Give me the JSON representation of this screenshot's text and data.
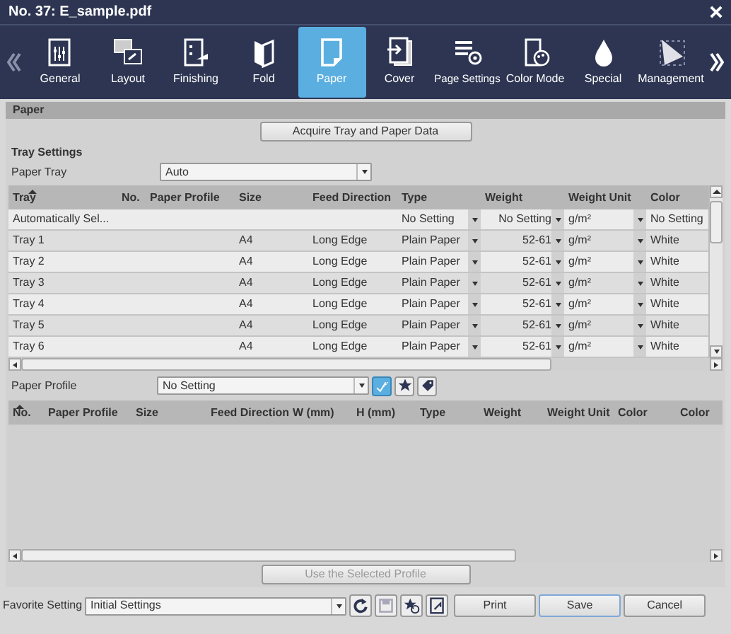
{
  "window": {
    "title": "No. 37: E_sample.pdf"
  },
  "tabs": [
    {
      "label": "General",
      "selected": false
    },
    {
      "label": "Layout",
      "selected": false
    },
    {
      "label": "Finishing",
      "selected": false
    },
    {
      "label": "Fold",
      "selected": false
    },
    {
      "label": "Paper",
      "selected": true
    },
    {
      "label": "Cover",
      "selected": false
    },
    {
      "label": "Page Settings",
      "selected": false
    },
    {
      "label": "Color Mode",
      "selected": false
    },
    {
      "label": "Special",
      "selected": false
    },
    {
      "label": "Management",
      "selected": false
    }
  ],
  "section_title": "Paper",
  "acquire_button": "Acquire Tray and Paper Data",
  "tray_settings": {
    "title": "Tray Settings",
    "paper_tray_label": "Paper Tray",
    "paper_tray_value": "Auto"
  },
  "tray_table": {
    "columns": [
      {
        "label": "Tray",
        "sorted": true
      },
      {
        "label": "No.",
        "sorted": false
      },
      {
        "label": "Paper Profile",
        "sorted": false
      },
      {
        "label": "Size",
        "sorted": false
      },
      {
        "label": "Feed Direction",
        "sorted": false
      },
      {
        "label": "Type",
        "sorted": false
      },
      {
        "label": "Weight",
        "sorted": false
      },
      {
        "label": "Weight Unit",
        "sorted": false
      },
      {
        "label": "Color",
        "sorted": false
      }
    ],
    "rows": [
      {
        "tray": "Automatically Sel...",
        "type": "No Setting",
        "weight": "No Setting",
        "unit": "g/m²",
        "paper_color": "No Setting"
      },
      {
        "tray": "Tray 1",
        "size": "A4",
        "feed": "Long Edge",
        "type": "Plain Paper",
        "weight": "52-61",
        "unit": "g/m²",
        "paper_color": "White"
      },
      {
        "tray": "Tray 2",
        "size": "A4",
        "feed": "Long Edge",
        "type": "Plain Paper",
        "weight": "52-61",
        "unit": "g/m²",
        "paper_color": "White"
      },
      {
        "tray": "Tray 3",
        "size": "A4",
        "feed": "Long Edge",
        "type": "Plain Paper",
        "weight": "52-61",
        "unit": "g/m²",
        "paper_color": "White"
      },
      {
        "tray": "Tray 4",
        "size": "A4",
        "feed": "Long Edge",
        "type": "Plain Paper",
        "weight": "52-61",
        "unit": "g/m²",
        "paper_color": "White"
      },
      {
        "tray": "Tray 5",
        "size": "A4",
        "feed": "Long Edge",
        "type": "Plain Paper",
        "weight": "52-61",
        "unit": "g/m²",
        "paper_color": "White"
      },
      {
        "tray": "Tray 6",
        "size": "A4",
        "feed": "Long Edge",
        "type": "Plain Paper",
        "weight": "52-61",
        "unit": "g/m²",
        "paper_color": "White"
      }
    ]
  },
  "paper_profile": {
    "label": "Paper Profile",
    "value": "No Setting",
    "filters": [
      {
        "selected": true
      },
      {
        "selected": false
      },
      {
        "selected": false
      }
    ]
  },
  "profile_table": {
    "columns": [
      {
        "label": "No.",
        "sorted": true
      },
      {
        "label": "Paper Profile",
        "sorted": false
      },
      {
        "label": "Size",
        "sorted": false
      },
      {
        "label": "Feed Direction",
        "sorted": false
      },
      {
        "label": "W (mm)",
        "sorted": false
      },
      {
        "label": "H (mm)",
        "sorted": false
      },
      {
        "label": "Type",
        "sorted": false
      },
      {
        "label": "Weight",
        "sorted": false
      },
      {
        "label": "Weight Unit",
        "sorted": false
      },
      {
        "label": "Color",
        "sorted": false
      },
      {
        "label": "Color",
        "sorted": false
      }
    ]
  },
  "use_profile_button": {
    "label": "Use the Selected Profile",
    "disabled": true
  },
  "footer": {
    "favorite_label": "Favorite Setting",
    "favorite_value": "Initial Settings",
    "tools": [
      {
        "disabled": false
      },
      {
        "disabled": true
      },
      {
        "disabled": false
      },
      {
        "disabled": false
      }
    ],
    "buttons": [
      {
        "label": "Print",
        "focused": false
      },
      {
        "label": "Save",
        "focused": true
      },
      {
        "label": "Cancel",
        "focused": false
      }
    ]
  }
}
